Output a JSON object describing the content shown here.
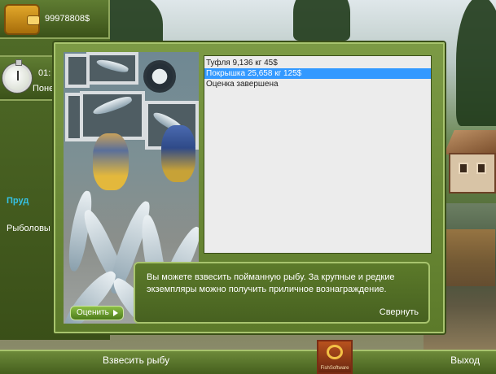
{
  "wallet": {
    "balance": "99978808$",
    "icon": "wallet-icon"
  },
  "timer": {
    "time": "01:",
    "status": "Поне",
    "icon": "stopwatch-icon"
  },
  "locations": {
    "pond": "Пруд",
    "fisher": "Рыболовы"
  },
  "dialog": {
    "items": [
      {
        "label": "Туфля 9,136 кг 45$",
        "selected": false
      },
      {
        "label": "Покрышка 25,658 кг 125$",
        "selected": true
      },
      {
        "label": "Оценка завершена",
        "selected": false
      }
    ],
    "info_text": "Вы можете взвесить пойманную рыбу. За крупные и редкие экземпляры можно получить приличное вознаграждение.",
    "collapse_label": "Свернуть",
    "evaluate_label": "Оценить"
  },
  "bottom_bar": {
    "weigh_label": "Взвесить рыбу",
    "exit_label": "Выход",
    "logo_text": "FishSoftware"
  },
  "colors": {
    "panel_green": "#5c7a2a",
    "accent_blue": "#3399ff",
    "location_accent": "#35c2e6"
  }
}
